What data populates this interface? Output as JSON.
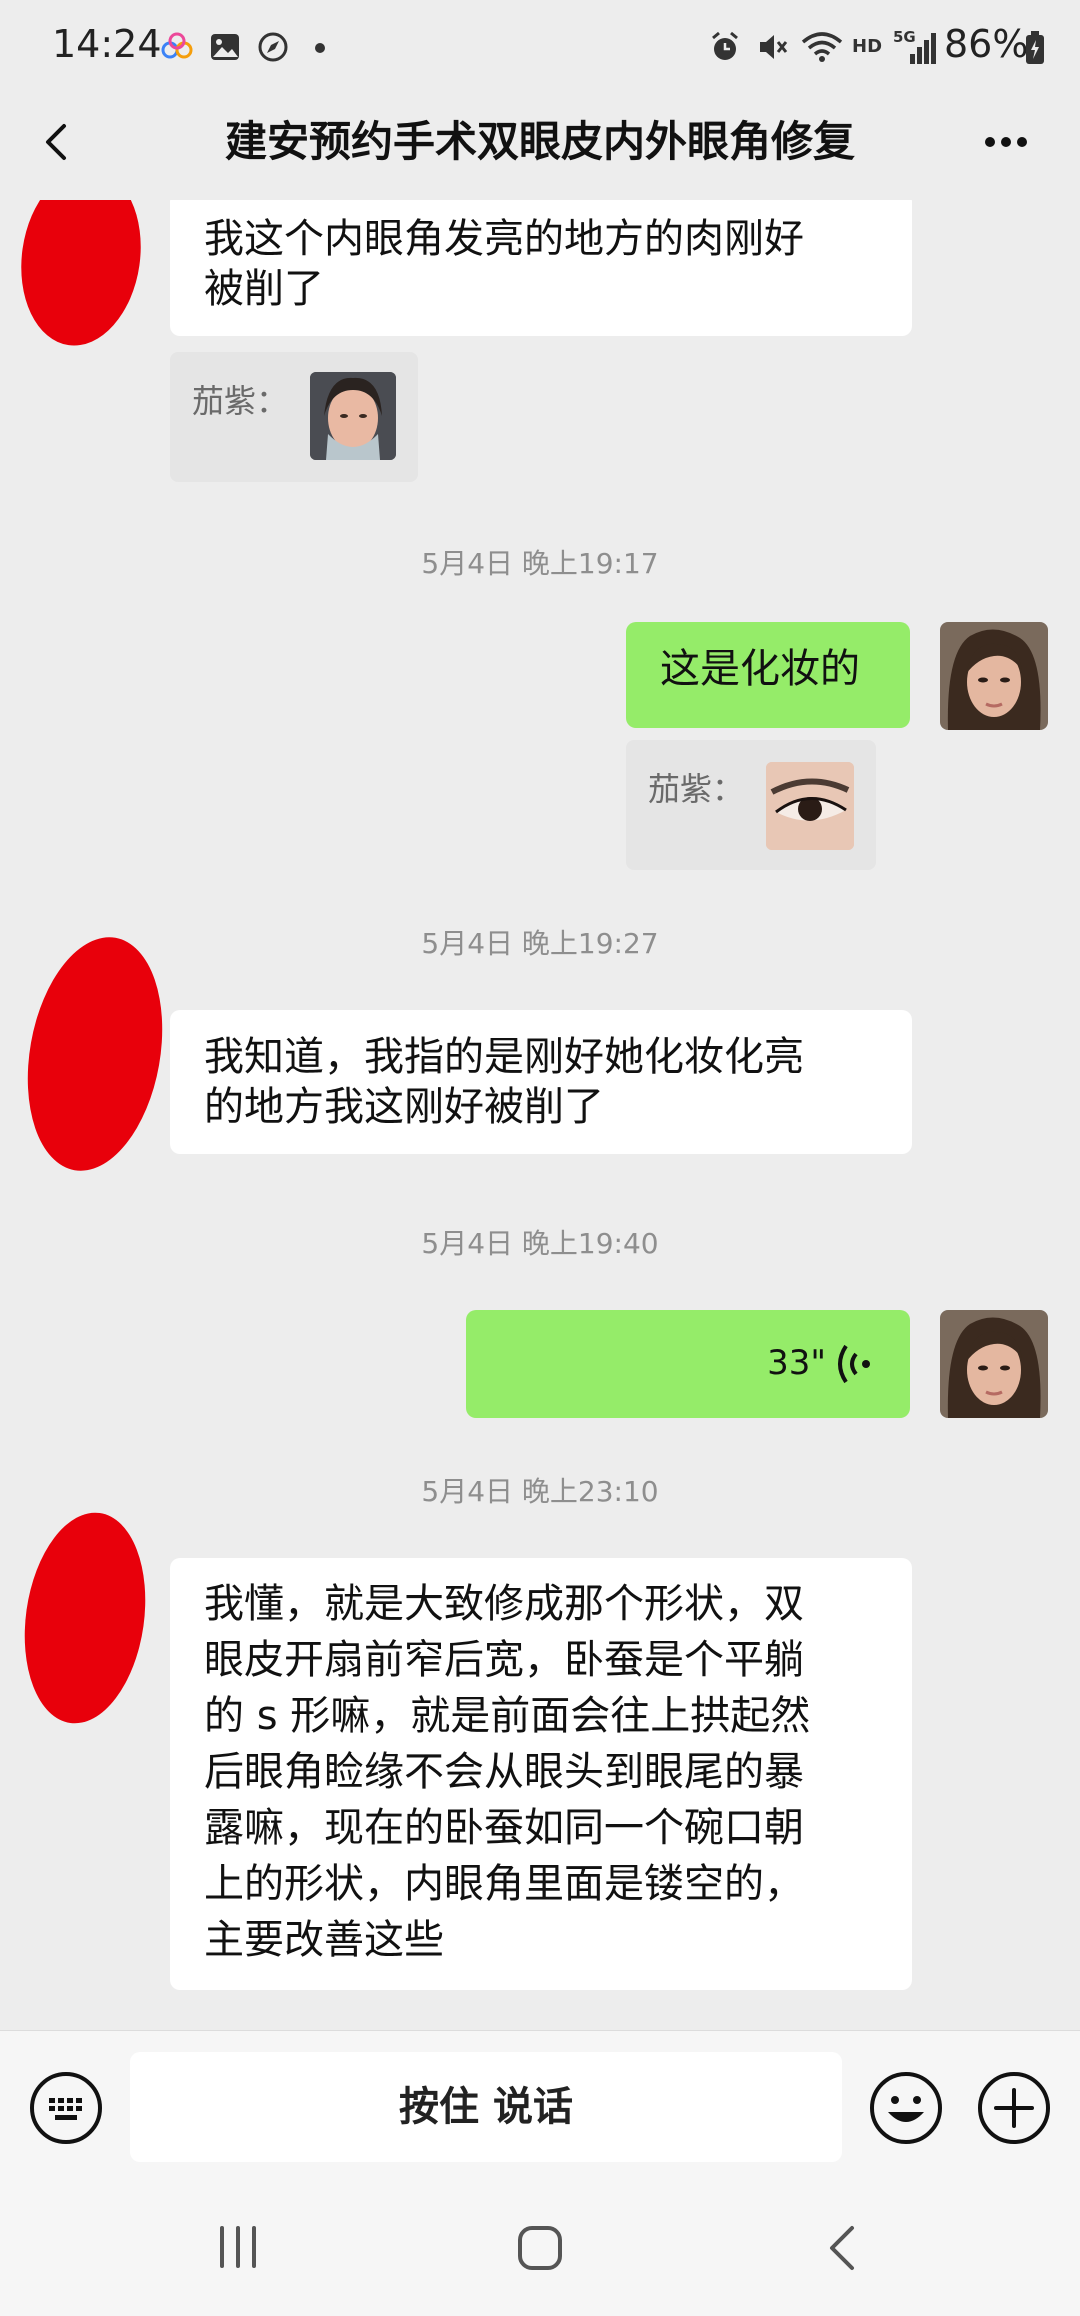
{
  "status_bar": {
    "time": "14:24",
    "battery": "86%",
    "network_label": "HD",
    "signal_label": "5G",
    "left_icons": [
      "cloud-icon",
      "gallery-icon",
      "compass-icon",
      "dot-icon"
    ],
    "right_icons": [
      "alarm-icon",
      "mute-icon",
      "wifi-icon",
      "signal-icon",
      "battery-icon"
    ]
  },
  "header": {
    "title": "建安预约手术双眼皮内外眼角修复",
    "back_icon": "chevron-left-icon",
    "more_icon": "more-dots-icon"
  },
  "messages": [
    {
      "side": "left",
      "lines": [
        "我这个内眼角发亮的地方的肉刚好",
        "被削了"
      ]
    },
    {
      "type": "quote",
      "side": "left",
      "label": "茄紫：",
      "thumb": "face-photo-thumbnail"
    },
    {
      "type": "timestamp",
      "text": "5月4日 晚上19:17"
    },
    {
      "side": "right",
      "lines": [
        "这是化妆的"
      ]
    },
    {
      "type": "quote",
      "side": "right",
      "label": "茄紫：",
      "thumb": "eye-photo-thumbnail"
    },
    {
      "type": "timestamp",
      "text": "5月4日 晚上19:27"
    },
    {
      "side": "left",
      "lines": [
        "我知道，我指的是刚好她化妆化亮",
        "的地方我这刚好被削了"
      ]
    },
    {
      "type": "timestamp",
      "text": "5月4日 晚上19:40"
    },
    {
      "side": "right",
      "type": "voice",
      "duration": "33\""
    },
    {
      "type": "timestamp",
      "text": "5月4日 晚上23:10"
    },
    {
      "side": "left",
      "lines": [
        "我懂，就是大致修成那个形状，双",
        "眼皮开扇前窄后宽，卧蚕是个平躺",
        "的 s 形嘛，就是前面会往上拱起然",
        "后眼角睑缘不会从眼头到眼尾的暴",
        "露嘛，现在的卧蚕如同一个碗口朝",
        "上的形状，内眼角里面是镂空的，",
        "主要改善这些"
      ]
    }
  ],
  "input_bar": {
    "hold_to_talk": "按住 说话",
    "keyboard_icon": "keyboard-icon",
    "emoji_icon": "emoji-icon",
    "plus_icon": "plus-icon"
  },
  "nav_bar": {
    "icons": [
      "recent-apps-icon",
      "home-icon",
      "back-icon"
    ]
  },
  "colors": {
    "background": "#ededed",
    "bubble_left": "#ffffff",
    "bubble_right": "#95ec69",
    "redaction": "#e8000b",
    "timestamp": "#8e8e8e"
  }
}
